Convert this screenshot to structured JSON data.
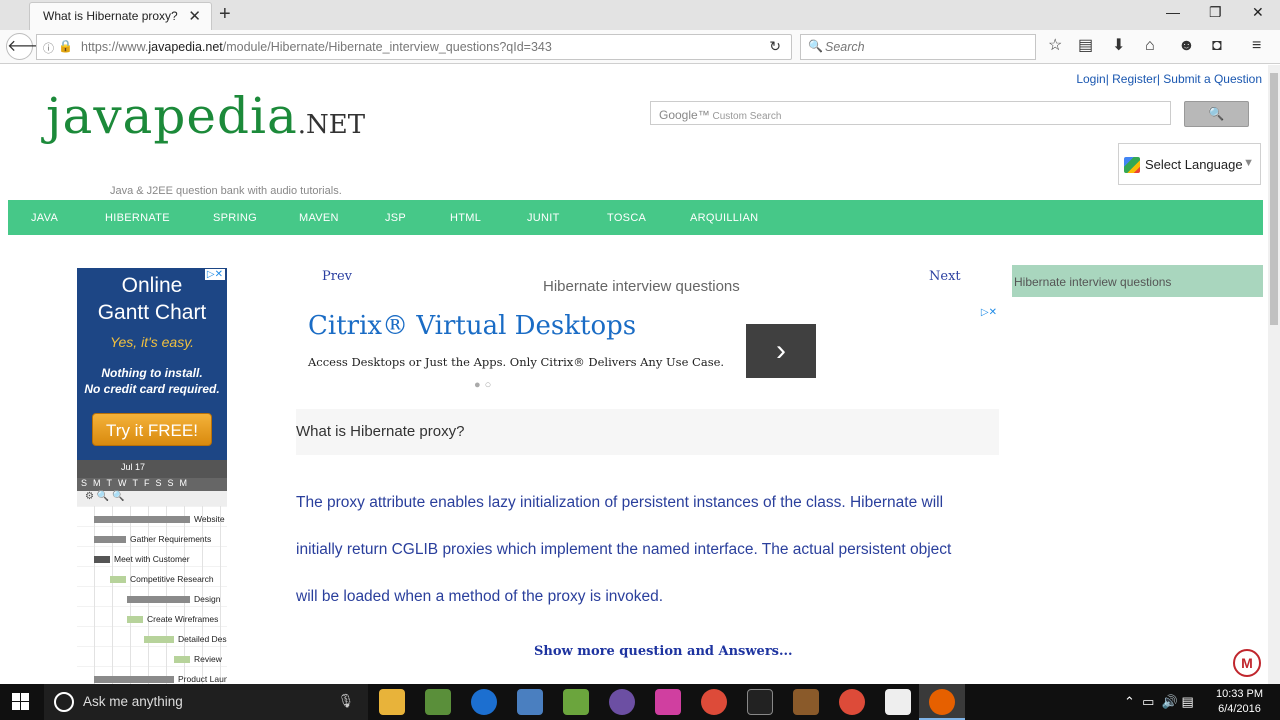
{
  "browser": {
    "tab_title": "What is Hibernate proxy?",
    "tab_close": "✕",
    "new_tab": "+",
    "url_prefix": "https://www.",
    "url_domain": "javapedia.net",
    "url_path": "/module/Hibernate/Hibernate_interview_questions?qId=343",
    "search_placeholder": "Search",
    "window_minimize": "—",
    "window_maximize": "❐",
    "window_close": "✕"
  },
  "site": {
    "top_links": "Login| Register| Submit a Question",
    "logo_main": "javapedia",
    "logo_suffix": ".NET",
    "tagline": "Java & J2EE question bank with audio tutorials.",
    "search_brand": "Google™",
    "search_placeholder": "Custom Search",
    "search_button": "🔍",
    "language_label": "Select Language",
    "language_arrow": "▼",
    "menu": [
      "JAVA",
      "HIBERNATE",
      "SPRING",
      "MAVEN",
      "JSP",
      "HTML",
      "JUNIT",
      "TOSCA",
      "ARQUILLIAN"
    ]
  },
  "left_ad": {
    "line1": "Online",
    "line2": "Gantt Chart",
    "yes": "Yes, it's easy.",
    "note1": "Nothing to install.",
    "note2": "No credit card required.",
    "cta": "Try it FREE!",
    "month": "Jul 17",
    "days": "SMTWTFSSM",
    "tasks": [
      "Website",
      "Gather Requirements",
      "Meet with Customer",
      "Competitive Research",
      "Design",
      "Create Wireframes",
      "Detailed Des",
      "Review",
      "Product Laun"
    ]
  },
  "content": {
    "prev": "Prev",
    "next": "Next",
    "heading": "Hibernate interview questions",
    "ad_headline": "Citrix® Virtual Desktops",
    "ad_desc": "Access Desktops or Just the Apps. Only Citrix® Delivers Any Use Case.",
    "ad_go": "›",
    "question": "What is Hibernate proxy?",
    "answer_lines": [
      "The proxy attribute enables lazy initialization of persistent instances of the class. Hibernate will",
      "initially return CGLIB proxies which implement the named interface. The actual persistent object",
      "will be loaded when a method of the proxy is invoked."
    ],
    "more_link": "Show more question and Answers..."
  },
  "sidebar": {
    "title": "Hibernate interview questions"
  },
  "taskbar": {
    "search_text": "Ask me anything",
    "time": "10:33 PM",
    "date": "6/4/2016"
  },
  "colors": {
    "menu_green": "#46c888",
    "sidebar_green": "#a9d6be",
    "link_blue": "#2a3f9c"
  }
}
